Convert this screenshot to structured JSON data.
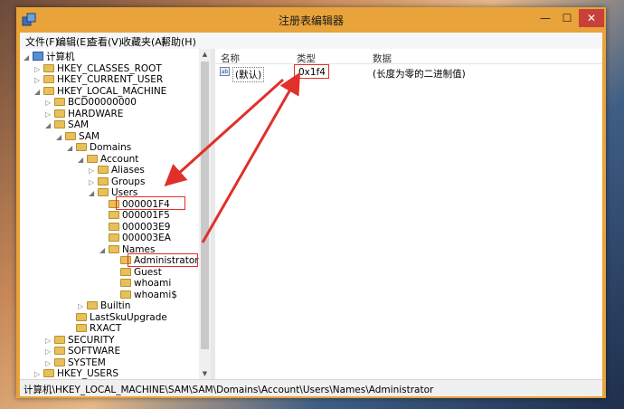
{
  "window": {
    "title": "注册表编辑器"
  },
  "controls": {
    "minimize": "—",
    "maximize": "☐",
    "close": "✕"
  },
  "menu": [
    "文件(F)",
    "编辑(E)",
    "查看(V)",
    "收藏夹(A)",
    "帮助(H)"
  ],
  "tree": [
    {
      "label": "计算机",
      "toggle": "◢"
    },
    {
      "label": "HKEY_CLASSES_ROOT",
      "toggle": "▷"
    },
    {
      "label": "HKEY_CURRENT_USER",
      "toggle": "▷"
    },
    {
      "label": "HKEY_LOCAL_MACHINE",
      "toggle": "◢"
    },
    {
      "label": "BCD00000000",
      "toggle": "▷"
    },
    {
      "label": "HARDWARE",
      "toggle": "▷"
    },
    {
      "label": "SAM",
      "toggle": "◢"
    },
    {
      "label": "SAM",
      "toggle": "◢"
    },
    {
      "label": "Domains",
      "toggle": "◢"
    },
    {
      "label": "Account",
      "toggle": "◢"
    },
    {
      "label": "Aliases",
      "toggle": "▷"
    },
    {
      "label": "Groups",
      "toggle": "▷"
    },
    {
      "label": "Users",
      "toggle": "◢"
    },
    {
      "label": "000001F4",
      "toggle": ""
    },
    {
      "label": "000001F5",
      "toggle": ""
    },
    {
      "label": "000003E9",
      "toggle": ""
    },
    {
      "label": "000003EA",
      "toggle": ""
    },
    {
      "label": "Names",
      "toggle": "◢"
    },
    {
      "label": "Administrator",
      "toggle": ""
    },
    {
      "label": "Guest",
      "toggle": ""
    },
    {
      "label": "whoami",
      "toggle": ""
    },
    {
      "label": "whoami$",
      "toggle": ""
    },
    {
      "label": "Builtin",
      "toggle": "▷"
    },
    {
      "label": "LastSkuUpgrade",
      "toggle": ""
    },
    {
      "label": "RXACT",
      "toggle": ""
    },
    {
      "label": "SECURITY",
      "toggle": "▷"
    },
    {
      "label": "SOFTWARE",
      "toggle": "▷"
    },
    {
      "label": "SYSTEM",
      "toggle": "▷"
    },
    {
      "label": "HKEY_USERS",
      "toggle": "▷"
    }
  ],
  "list": {
    "columns": [
      "名称",
      "类型",
      "数据"
    ],
    "rows": [
      {
        "name": "(默认)",
        "type": "0x1f4",
        "data": "(长度为零的二进制值)",
        "icon": "ab"
      }
    ]
  },
  "status": "计算机\\HKEY_LOCAL_MACHINE\\SAM\\SAM\\Domains\\Account\\Users\\Names\\Administrator",
  "colors": {
    "accent": "#e8a33a",
    "annotation": "#e0302a"
  }
}
